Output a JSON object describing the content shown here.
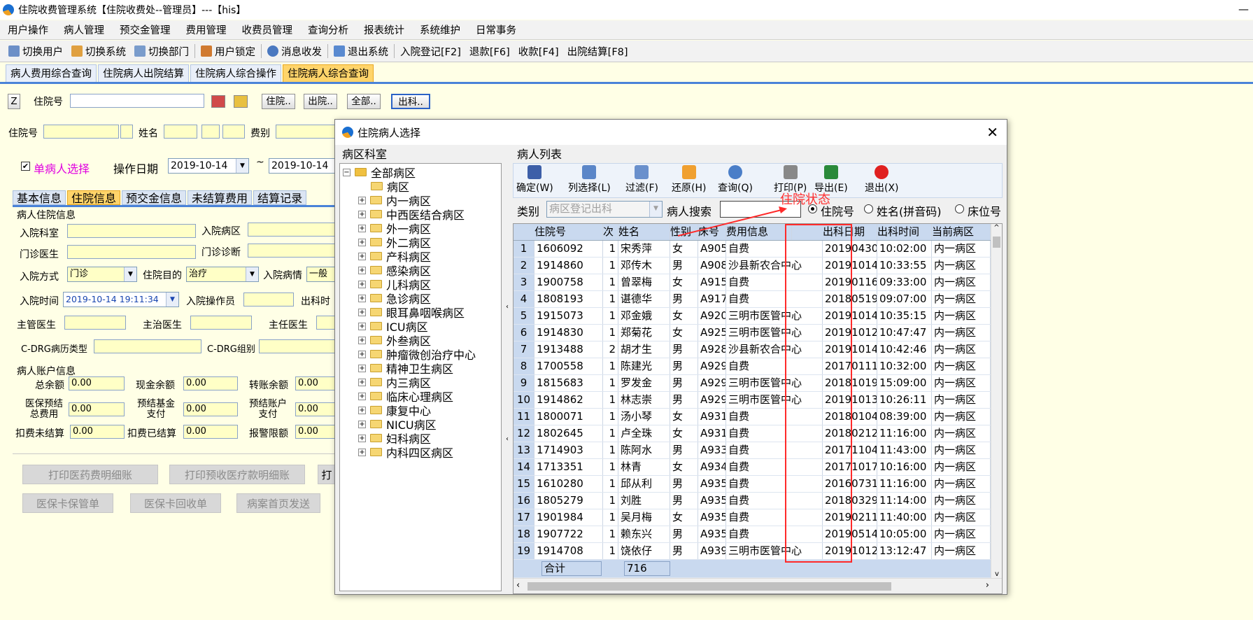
{
  "window": {
    "title": "住院收费管理系统【住院收费处--管理员】---【his】"
  },
  "menu": [
    "用户操作",
    "病人管理",
    "预交金管理",
    "费用管理",
    "收费员管理",
    "查询分析",
    "报表统计",
    "系统维护",
    "日常事务"
  ],
  "toolbar": [
    "切换用户",
    "切换系统",
    "切换部门",
    "用户锁定",
    "消息收发",
    "退出系统",
    "入院登记[F2]",
    "退款[F6]",
    "收款[F4]",
    "出院结算[F8]"
  ],
  "main_tabs": [
    "病人费用综合查询",
    "住院病人出院结算",
    "住院病人综合操作",
    "住院病人综合查询"
  ],
  "search": {
    "z_label": "Z",
    "zyh_label": "住院号",
    "btn_zy": "住院..",
    "btn_cy": "出院..",
    "btn_all": "全部..",
    "btn_ck": "出科.."
  },
  "info": {
    "zyh": "住院号",
    "name": "姓名",
    "feibie": "费别"
  },
  "options": {
    "single": "单病人选择",
    "date_label": "操作日期",
    "date_from": "2019-10-14",
    "tilde": "~",
    "date_to": "2019-10-14"
  },
  "sub_tabs": [
    "基本信息",
    "住院信息",
    "预交金信息",
    "未结算费用",
    "结算记录"
  ],
  "hosp": {
    "group": "病人住院信息",
    "dept": "入院科室",
    "ward": "入院病区",
    "doctor": "门诊医生",
    "diag": "门诊诊断",
    "mode": "入院方式",
    "mode_val": "门诊",
    "purpose": "住院目的",
    "purpose_val": "治疗",
    "cond": "入院病情",
    "cond_val": "一般",
    "time": "入院时间",
    "time_val": "2019-10-14 19:11:34",
    "operator": "入院操作员",
    "out_time": "出科时",
    "chief": "主管医生",
    "attending": "主治医生",
    "director": "主任医生",
    "drg_type": "C-DRG病历类型",
    "drg_group": "C-DRG组别"
  },
  "account": {
    "group": "病人账户信息",
    "total": "总余额",
    "total_val": "0.00",
    "cash": "现金余额",
    "cash_val": "0.00",
    "trans": "转账余额",
    "trans_val": "0.00",
    "ins_total": "医保预结\n总费用",
    "ins_total_val": "0.00",
    "fund": "预结基金\n支付",
    "fund_val": "0.00",
    "acct": "预结账户\n支付",
    "acct_val": "0.00",
    "unsettled": "扣费未结算",
    "unsettled_val": "0.00",
    "settled": "扣费已结算",
    "settled_val": "0.00",
    "alarm": "报警限额",
    "alarm_val": "0.00"
  },
  "bottom_btns": [
    "打印医药费明细账",
    "打印预收医疗款明细账",
    "打",
    "医保卡保管单",
    "医保卡回收单",
    "病案首页发送"
  ],
  "dialog": {
    "title": "住院病人选择",
    "tree_label": "病区科室",
    "list_label": "病人列表",
    "tree": [
      "全部病区",
      "病区",
      "内一病区",
      "中西医结合病区",
      "外一病区",
      "外二病区",
      "产科病区",
      "感染病区",
      "儿科病区",
      "急诊病区",
      "眼耳鼻咽喉病区",
      "ICU病区",
      "外叁病区",
      "肿瘤微创治疗中心",
      "精神卫生病区",
      "内三病区",
      "临床心理病区",
      "康复中心",
      "NICU病区",
      "妇科病区",
      "内科四区病区"
    ],
    "tools": [
      "确定(W)",
      "列选择(L)",
      "过滤(F)",
      "还原(H)",
      "查询(Q)",
      "打印(P)",
      "导出(E)",
      "退出(X)"
    ],
    "category_label": "类别",
    "category_val": "病区登记出科",
    "search_label": "病人搜索",
    "annotation": "住院状态",
    "radios": [
      "住院号",
      "姓名(拼音码)",
      "床位号"
    ],
    "columns": [
      "住院号",
      "次",
      "姓名",
      "性别",
      "床号",
      "费用信息",
      "出科日期",
      "出科时间",
      "当前病区"
    ],
    "rows": [
      [
        "1",
        "1606092",
        "1",
        "宋秀萍",
        "女",
        "A905",
        "自费",
        "20190430",
        "10:02:00",
        "内一病区"
      ],
      [
        "2",
        "1914860",
        "1",
        "邓传木",
        "男",
        "A908",
        "沙县新农合中心",
        "20191014",
        "10:33:55",
        "内一病区"
      ],
      [
        "3",
        "1900758",
        "1",
        "曾翠梅",
        "女",
        "A915",
        "自费",
        "20190116",
        "09:33:00",
        "内一病区"
      ],
      [
        "4",
        "1808193",
        "1",
        "谌德华",
        "男",
        "A917",
        "自费",
        "20180519",
        "09:07:00",
        "内一病区"
      ],
      [
        "5",
        "1915073",
        "1",
        "邓金娥",
        "女",
        "A920",
        "三明市医管中心",
        "20191014",
        "10:35:15",
        "内一病区"
      ],
      [
        "6",
        "1914830",
        "1",
        "郑菊花",
        "女",
        "A925",
        "三明市医管中心",
        "20191012",
        "10:47:47",
        "内一病区"
      ],
      [
        "7",
        "1913488",
        "2",
        "胡才生",
        "男",
        "A928",
        "沙县新农合中心",
        "20191014",
        "10:42:46",
        "内一病区"
      ],
      [
        "8",
        "1700558",
        "1",
        "陈建光",
        "男",
        "A929",
        "自费",
        "20170111",
        "10:32:00",
        "内一病区"
      ],
      [
        "9",
        "1815683",
        "1",
        "罗发金",
        "男",
        "A929",
        "三明市医管中心",
        "20181019",
        "15:09:00",
        "内一病区"
      ],
      [
        "10",
        "1914862",
        "1",
        "林志崇",
        "男",
        "A929",
        "三明市医管中心",
        "20191013",
        "10:26:11",
        "内一病区"
      ],
      [
        "11",
        "1800071",
        "1",
        "汤小琴",
        "女",
        "A931",
        "自费",
        "20180104",
        "08:39:00",
        "内一病区"
      ],
      [
        "12",
        "1802645",
        "1",
        "卢全珠",
        "女",
        "A931",
        "自费",
        "20180212",
        "11:16:00",
        "内一病区"
      ],
      [
        "13",
        "1714903",
        "1",
        "陈阿水",
        "男",
        "A933",
        "自费",
        "20171104",
        "11:43:00",
        "内一病区"
      ],
      [
        "14",
        "1713351",
        "1",
        "林青",
        "女",
        "A934",
        "自费",
        "20171017",
        "10:16:00",
        "内一病区"
      ],
      [
        "15",
        "1610280",
        "1",
        "邱从利",
        "男",
        "A935",
        "自费",
        "20160731",
        "11:16:00",
        "内一病区"
      ],
      [
        "16",
        "1805279",
        "1",
        "刘胜",
        "男",
        "A935",
        "自费",
        "20180329",
        "11:14:00",
        "内一病区"
      ],
      [
        "17",
        "1901984",
        "1",
        "吴月梅",
        "女",
        "A935",
        "自费",
        "20190211",
        "11:40:00",
        "内一病区"
      ],
      [
        "18",
        "1907722",
        "1",
        "赖东兴",
        "男",
        "A935",
        "自费",
        "20190514",
        "10:05:00",
        "内一病区"
      ],
      [
        "19",
        "1914708",
        "1",
        "饶依仔",
        "男",
        "A939",
        "三明市医管中心",
        "20191012",
        "13:12:47",
        "内一病区"
      ]
    ],
    "total_label": "合计",
    "total_val": "716"
  }
}
